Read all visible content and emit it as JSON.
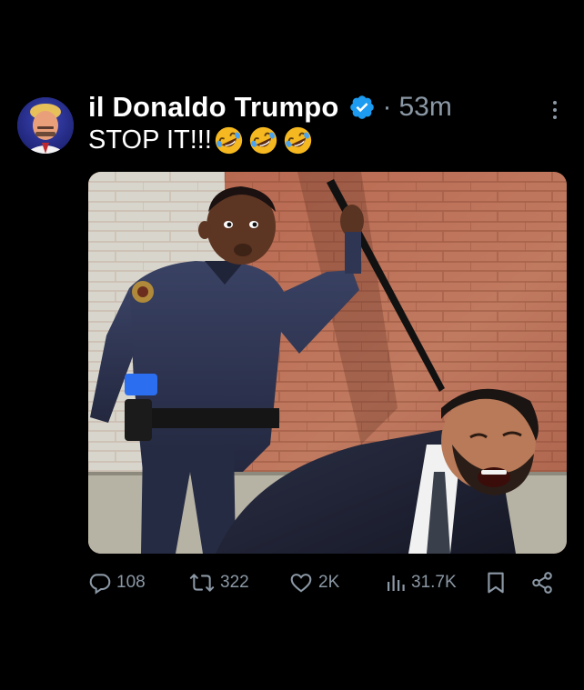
{
  "post": {
    "author": {
      "display_name": "il Donaldo Trumpo",
      "verified": true,
      "avatar_icon": "avatar-photo"
    },
    "separator": "·",
    "time": "53m",
    "text": "STOP IT!!!",
    "emoji_icon": "rolling-on-floor-laughing-emoji",
    "emoji_count": 3,
    "media": {
      "type": "photo",
      "icon": "police-officer-meme-photo"
    },
    "stats": {
      "replies": "108",
      "reposts": "322",
      "likes": "2K",
      "views": "31.7K"
    }
  },
  "colors": {
    "background": "#000000",
    "text_primary": "#ffffff",
    "text_secondary": "#8b98a5",
    "verified_blue": "#1d9bf0"
  }
}
